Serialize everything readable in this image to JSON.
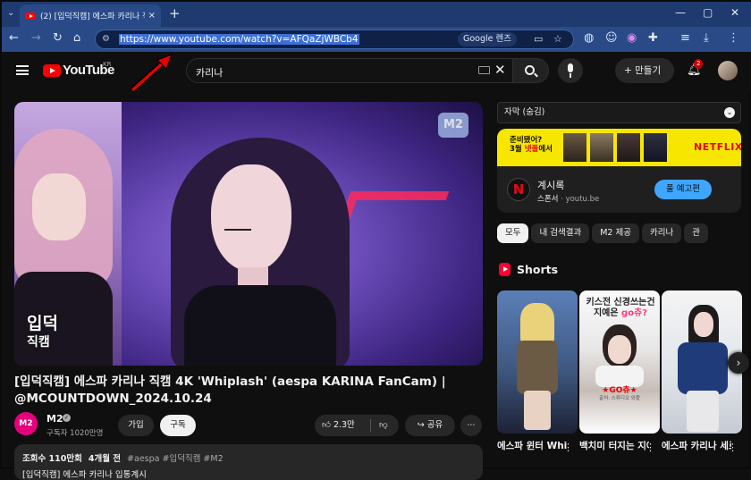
{
  "browser": {
    "tab_title": "(2) [입덕직캠] 에스파 카리나 직",
    "tab_close": "×",
    "new_tab": "+",
    "tab_search": "⌄",
    "url": "https://www.youtube.com/watch?v=AFQaZjWBCb4",
    "lens_label": "Google 렌즈",
    "window_controls": {
      "minimize": "—",
      "maximize": "▢",
      "close": "✕"
    }
  },
  "youtube": {
    "logo_text": "YouTube",
    "region": "KR",
    "search_value": "카리나",
    "create_label": "+ 만들기",
    "notification_count": "2"
  },
  "video": {
    "overlay_logo": "M2",
    "overlay_badge_line1": "입덕",
    "overlay_badge_line2": "직캠",
    "title": "[입덕직캠] 에스파 카리나 직캠 4K 'Whiplash' (aespa KARINA FanCam) | @MCOUNTDOWN_2024.10.24",
    "channel_name": "M2",
    "channel_avatar": "M2",
    "subscribers": "구독자 1020만명",
    "join_label": "가입",
    "subscribe_label": "구독",
    "like_count": "2.3만",
    "share_label": "공유",
    "views": "조회수 110만회",
    "age": "4개월 전",
    "tags": "#aespa #입덕직캠 #M2",
    "desc_line2": "[입덕직캠] 에스파 카리나 입통계시"
  },
  "sidebar": {
    "caption_label": "자막 (숨김)",
    "ad": {
      "banner_text_a": "준비됐어?",
      "banner_text_b": "3월 ",
      "banner_text_red": "넷플",
      "banner_text_c": "에서",
      "banner_brand": "NETFLIX",
      "title": "계시록",
      "sponsor_label": "스폰서",
      "domain": "youtu.be",
      "button_label": "풀 예고편"
    },
    "chips": [
      "모두",
      "내 검색결과",
      "M2 제공",
      "카리나",
      "관"
    ],
    "shorts_title": "Shorts",
    "shorts": [
      {
        "label": "에스파 윈터 Whiplash ..."
      },
      {
        "label": "백치미 터지는 지예은 ...",
        "overlay_a": "키스전",
        "overlay_b": "신경쓰는건",
        "overlay_c": "지예은",
        "overlay_d": "go츄?",
        "overlay_red": "★GO츄★",
        "overlay_caption": "출처: 스튜디오 와플"
      },
      {
        "label": "에스파 카리나 세로 직..."
      }
    ]
  }
}
